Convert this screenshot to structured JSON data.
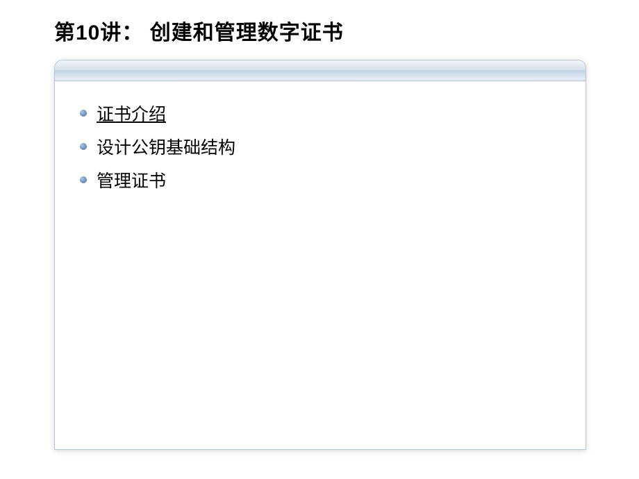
{
  "title": "第10讲： 创建和管理数字证书",
  "bullets": [
    {
      "text": "证书介绍",
      "underlined": true
    },
    {
      "text": "设计公钥基础结构",
      "underlined": false
    },
    {
      "text": "管理证书",
      "underlined": false
    }
  ]
}
